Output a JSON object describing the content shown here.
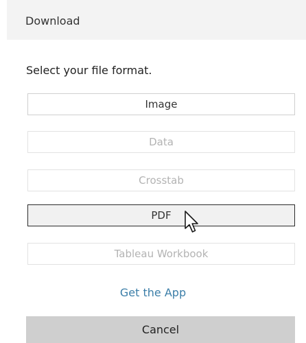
{
  "dialog": {
    "title": "Download"
  },
  "prompt": "Select your file format.",
  "formats": [
    {
      "label": "Image",
      "state": "enabled"
    },
    {
      "label": "Data",
      "state": "disabled"
    },
    {
      "label": "Crosstab",
      "state": "disabled"
    },
    {
      "label": "PDF",
      "state": "selected"
    },
    {
      "label": "Tableau Workbook",
      "state": "disabled"
    }
  ],
  "get_app_link": "Get the App",
  "cancel_label": "Cancel",
  "colors": {
    "header_bg": "#f3f3f3",
    "link": "#3b7ea8",
    "cancel_bg": "#cfcfcf",
    "selected_border": "#2a2a2a",
    "disabled_text": "#b3b3b3"
  },
  "icons": {
    "cursor": "pointer-arrow-icon"
  }
}
